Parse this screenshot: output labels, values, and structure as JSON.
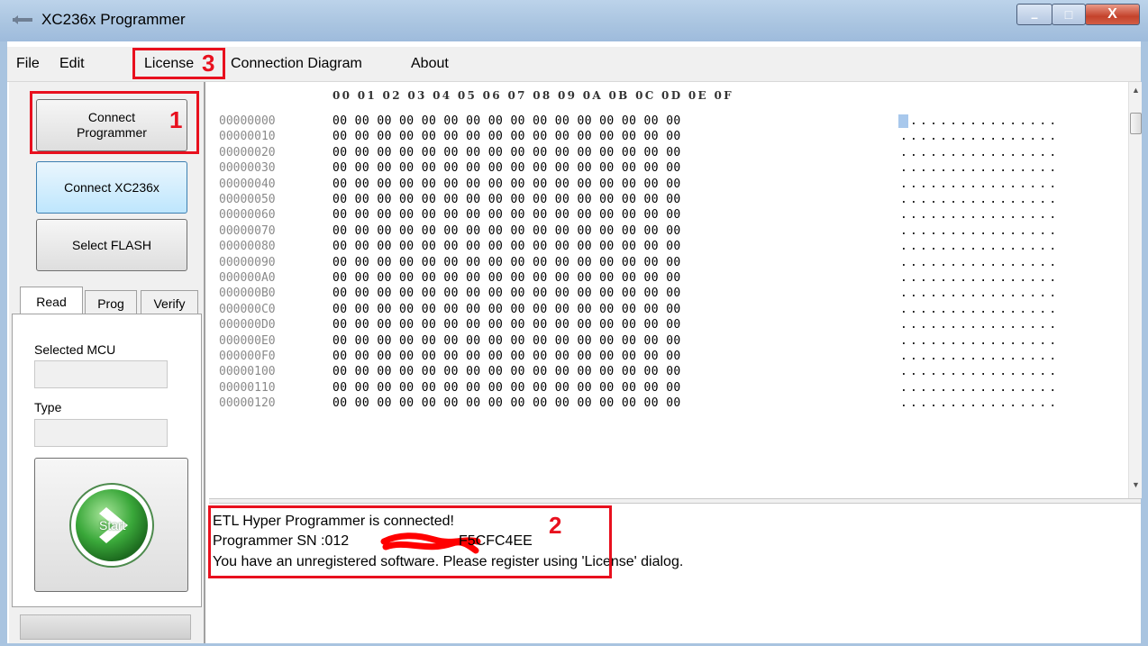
{
  "window": {
    "title": "XC236x Programmer",
    "minimize": "–",
    "maximize": "□",
    "close": "X"
  },
  "menu": {
    "items": [
      "File",
      "Edit",
      "License",
      "Connection Diagram",
      "About"
    ]
  },
  "annotations": {
    "n1": "1",
    "n2": "2",
    "n3": "3"
  },
  "left_panel": {
    "connect_programmer": "Connect Programmer",
    "connect_mcu": "Connect XC236x",
    "select_flash": "Select FLASH",
    "tabs": [
      "Read",
      "Prog",
      "Verify"
    ],
    "selected_mcu_label": "Selected MCU",
    "selected_mcu_value": "",
    "type_label": "Type",
    "type_value": "",
    "start_label": "Start"
  },
  "hex": {
    "header": "00 01 02 03 04 05 06 07 08 09 0A 0B 0C 0D 0E 0F",
    "rows": [
      {
        "addr": "00000000",
        "bytes": "00 00 00 00 00 00 00 00 00 00 00 00 00 00 00 00",
        "ascii": "................"
      },
      {
        "addr": "00000010",
        "bytes": "00 00 00 00 00 00 00 00 00 00 00 00 00 00 00 00",
        "ascii": "................"
      },
      {
        "addr": "00000020",
        "bytes": "00 00 00 00 00 00 00 00 00 00 00 00 00 00 00 00",
        "ascii": "................"
      },
      {
        "addr": "00000030",
        "bytes": "00 00 00 00 00 00 00 00 00 00 00 00 00 00 00 00",
        "ascii": "................"
      },
      {
        "addr": "00000040",
        "bytes": "00 00 00 00 00 00 00 00 00 00 00 00 00 00 00 00",
        "ascii": "................"
      },
      {
        "addr": "00000050",
        "bytes": "00 00 00 00 00 00 00 00 00 00 00 00 00 00 00 00",
        "ascii": "................"
      },
      {
        "addr": "00000060",
        "bytes": "00 00 00 00 00 00 00 00 00 00 00 00 00 00 00 00",
        "ascii": "................"
      },
      {
        "addr": "00000070",
        "bytes": "00 00 00 00 00 00 00 00 00 00 00 00 00 00 00 00",
        "ascii": "................"
      },
      {
        "addr": "00000080",
        "bytes": "00 00 00 00 00 00 00 00 00 00 00 00 00 00 00 00",
        "ascii": "................"
      },
      {
        "addr": "00000090",
        "bytes": "00 00 00 00 00 00 00 00 00 00 00 00 00 00 00 00",
        "ascii": "................"
      },
      {
        "addr": "000000A0",
        "bytes": "00 00 00 00 00 00 00 00 00 00 00 00 00 00 00 00",
        "ascii": "................"
      },
      {
        "addr": "000000B0",
        "bytes": "00 00 00 00 00 00 00 00 00 00 00 00 00 00 00 00",
        "ascii": "................"
      },
      {
        "addr": "000000C0",
        "bytes": "00 00 00 00 00 00 00 00 00 00 00 00 00 00 00 00",
        "ascii": "................"
      },
      {
        "addr": "000000D0",
        "bytes": "00 00 00 00 00 00 00 00 00 00 00 00 00 00 00 00",
        "ascii": "................"
      },
      {
        "addr": "000000E0",
        "bytes": "00 00 00 00 00 00 00 00 00 00 00 00 00 00 00 00",
        "ascii": "................"
      },
      {
        "addr": "000000F0",
        "bytes": "00 00 00 00 00 00 00 00 00 00 00 00 00 00 00 00",
        "ascii": "................"
      },
      {
        "addr": "00000100",
        "bytes": "00 00 00 00 00 00 00 00 00 00 00 00 00 00 00 00",
        "ascii": "................"
      },
      {
        "addr": "00000110",
        "bytes": "00 00 00 00 00 00 00 00 00 00 00 00 00 00 00 00",
        "ascii": "................"
      },
      {
        "addr": "00000120",
        "bytes": "00 00 00 00 00 00 00 00 00 00 00 00 00 00 00 00",
        "ascii": "................"
      }
    ]
  },
  "log": {
    "lines": [
      "ETL Hyper Programmer is connected!",
      "Programmer SN :012",
      "You have an unregistered software. Please register using 'License' dialog."
    ],
    "sn_tail": "F5CFC4EE"
  },
  "colors": {
    "annotation_red": "#e8101e",
    "start_green": "#3aa83a"
  }
}
